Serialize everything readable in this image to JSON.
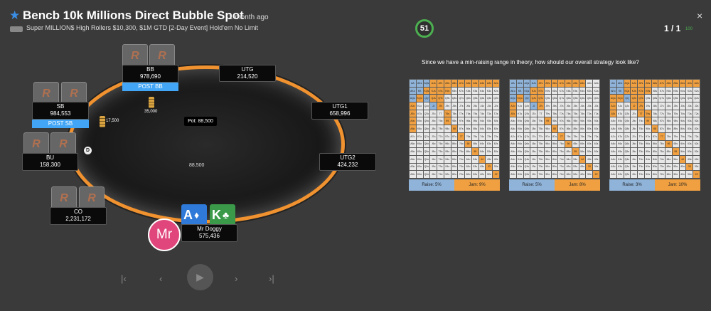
{
  "header": {
    "title": "Bencb 10k Millions Direct Bubble Spot",
    "time_ago": "1 month ago",
    "subtitle": "Super MILLION$ High Rollers $10,300, $1M GTD [2-Day Event] Hold'em No Limit",
    "score": "51",
    "pager": "1 / 1",
    "pager_pct": "100",
    "close_symbol": "×"
  },
  "table": {
    "pot_label": "Pot: 88,500",
    "center_amount": "88,500",
    "dealer_symbol": "D",
    "seats": {
      "bb": {
        "name": "BB",
        "stack": "978,690",
        "post": "POST BB",
        "bet": "35,000"
      },
      "utg": {
        "name": "UTG",
        "stack": "214,520"
      },
      "sb": {
        "name": "SB",
        "stack": "984,553",
        "post": "POST SB",
        "bet": "17,500"
      },
      "utg1": {
        "name": "UTG1",
        "stack": "658,996"
      },
      "bu": {
        "name": "BU",
        "stack": "158,300"
      },
      "utg2": {
        "name": "UTG2",
        "stack": "424,232"
      },
      "co": {
        "name": "CO",
        "stack": "2,231,172"
      },
      "hero": {
        "name": "Mr Doggy",
        "stack": "575,436",
        "avatar": "Mr",
        "card1_rank": "A",
        "card1_suit": "♦",
        "card2_rank": "K",
        "card2_suit": "♣"
      }
    },
    "cardback_logo": "R"
  },
  "controls": {
    "first": "|‹",
    "prev": "‹",
    "play": "▶",
    "next": "›",
    "last": "›|"
  },
  "strategy": {
    "question": "Since we have a min-raising range in theory, how should our overall strategy look like?",
    "hands": [
      [
        "AA",
        "AKs",
        "AQs",
        "AJs",
        "ATs",
        "A9s",
        "A8s",
        "A7s",
        "A6s",
        "A5s",
        "A4s",
        "A3s",
        "A2s"
      ],
      [
        "AKo",
        "KK",
        "KQs",
        "KJs",
        "KTs",
        "K9s",
        "K8s",
        "K7s",
        "K6s",
        "K5s",
        "K4s",
        "K3s",
        "K2s"
      ],
      [
        "AQo",
        "KQo",
        "QQ",
        "QJs",
        "QTs",
        "Q9s",
        "Q8s",
        "Q7s",
        "Q6s",
        "Q5s",
        "Q4s",
        "Q3s",
        "Q2s"
      ],
      [
        "AJo",
        "KJo",
        "QJo",
        "JJ",
        "JTs",
        "J9s",
        "J8s",
        "J7s",
        "J6s",
        "J5s",
        "J4s",
        "J3s",
        "J2s"
      ],
      [
        "ATo",
        "KTo",
        "QTo",
        "JTo",
        "TT",
        "T9s",
        "T8s",
        "T7s",
        "T6s",
        "T5s",
        "T4s",
        "T3s",
        "T2s"
      ],
      [
        "A9o",
        "K9o",
        "Q9o",
        "J9o",
        "T9o",
        "99",
        "98s",
        "97s",
        "96s",
        "95s",
        "94s",
        "93s",
        "92s"
      ],
      [
        "A8o",
        "K8o",
        "Q8o",
        "J8o",
        "T8o",
        "98o",
        "88",
        "87s",
        "86s",
        "85s",
        "84s",
        "83s",
        "82s"
      ],
      [
        "A7o",
        "K7o",
        "Q7o",
        "J7o",
        "T7o",
        "97o",
        "87o",
        "77",
        "76s",
        "75s",
        "74s",
        "73s",
        "72s"
      ],
      [
        "A6o",
        "K6o",
        "Q6o",
        "J6o",
        "T6o",
        "96o",
        "86o",
        "76o",
        "66",
        "65s",
        "64s",
        "63s",
        "62s"
      ],
      [
        "A5o",
        "K5o",
        "Q5o",
        "J5o",
        "T5o",
        "95o",
        "85o",
        "75o",
        "65o",
        "55",
        "54s",
        "53s",
        "52s"
      ],
      [
        "A4o",
        "K4o",
        "Q4o",
        "J4o",
        "T4o",
        "94o",
        "84o",
        "74o",
        "64o",
        "54o",
        "44",
        "43s",
        "42s"
      ],
      [
        "A3o",
        "K3o",
        "Q3o",
        "J3o",
        "T3o",
        "93o",
        "83o",
        "73o",
        "63o",
        "53o",
        "43o",
        "33",
        "32s"
      ],
      [
        "A2o",
        "K2o",
        "Q2o",
        "J2o",
        "T2o",
        "92o",
        "82o",
        "72o",
        "62o",
        "52o",
        "42o",
        "32o",
        "22"
      ]
    ],
    "colors": {
      "raise": "#8fb3d9",
      "jam": "#f0a040",
      "fold": "#e8e8e8",
      "grid": "#5a5a5a"
    },
    "options": [
      {
        "raise_label": "Raise: 5%",
        "jam_label": "Jam: 9%",
        "raise": [
          "AA",
          "AKs",
          "KK",
          "AKo",
          "QQ",
          "AQs",
          "AQo",
          "JJ"
        ],
        "jam": [
          "AJs",
          "ATs",
          "A9s",
          "A8s",
          "A7s",
          "A6s",
          "A5s",
          "A4s",
          "A3s",
          "A2s",
          "KQs",
          "KJs",
          "KTs",
          "K9s",
          "QJs",
          "QTs",
          "JTs",
          "T9s",
          "99",
          "88",
          "77",
          "66",
          "55",
          "44",
          "33",
          "22",
          "AJo",
          "ATo",
          "KQo",
          "A9o",
          "A8o"
        ]
      },
      {
        "raise_label": "Raise: 5%",
        "jam_label": "Jam: 8%",
        "raise": [
          "AA",
          "AKs",
          "KK",
          "AKo",
          "QQ",
          "AQs",
          "JJ",
          "KQs",
          "AJs",
          "AQo"
        ],
        "jam": [
          "ATs",
          "A9s",
          "A8s",
          "A7s",
          "A6s",
          "A5s",
          "A4s",
          "KJs",
          "KTs",
          "QJs",
          "QTs",
          "JTs",
          "99",
          "88",
          "77",
          "66",
          "55",
          "44",
          "AJo",
          "ATo",
          "KQo",
          "33",
          "22"
        ]
      },
      {
        "raise_label": "Raise: 3%",
        "jam_label": "Jam: 10%",
        "raise": [
          "AA",
          "KK",
          "QQ",
          "AKs",
          "AKo"
        ],
        "jam": [
          "AQs",
          "AJs",
          "ATs",
          "A9s",
          "A8s",
          "A7s",
          "A6s",
          "A5s",
          "A4s",
          "A3s",
          "A2s",
          "KQs",
          "KJs",
          "KTs",
          "K9s",
          "QJs",
          "QTs",
          "JTs",
          "T9s",
          "JJ",
          "TT",
          "99",
          "88",
          "77",
          "66",
          "55",
          "44",
          "33",
          "22",
          "AQo",
          "AJo",
          "ATo",
          "KQo"
        ]
      }
    ]
  }
}
